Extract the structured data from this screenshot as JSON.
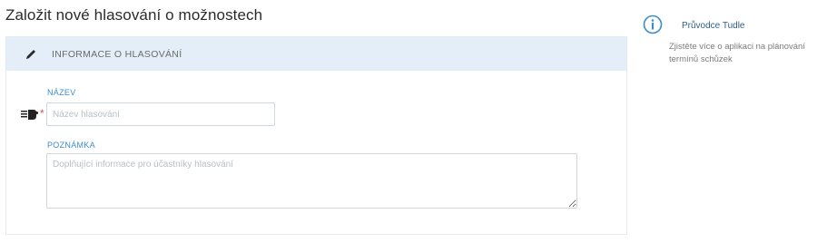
{
  "page": {
    "title": "Založit nové hlasování o možnostech"
  },
  "panel": {
    "header_label": "INFORMACE O HLASOVÁNÍ"
  },
  "form": {
    "name_label": "NÁZEV",
    "name_placeholder": "Název hlasování",
    "name_value": "",
    "note_label": "POZNÁMKA",
    "note_placeholder": "Doplňující informace pro účastníky hlasování",
    "note_value": ""
  },
  "help": {
    "title": "Průvodce Tudle",
    "text": "Zjistěte více o aplikaci na plánování termínů schůzek"
  },
  "colors": {
    "header_bg": "#e3eef8",
    "label_blue": "#3a8ccf",
    "info_blue": "#3a8ccf",
    "required_red": "#d9534f"
  }
}
